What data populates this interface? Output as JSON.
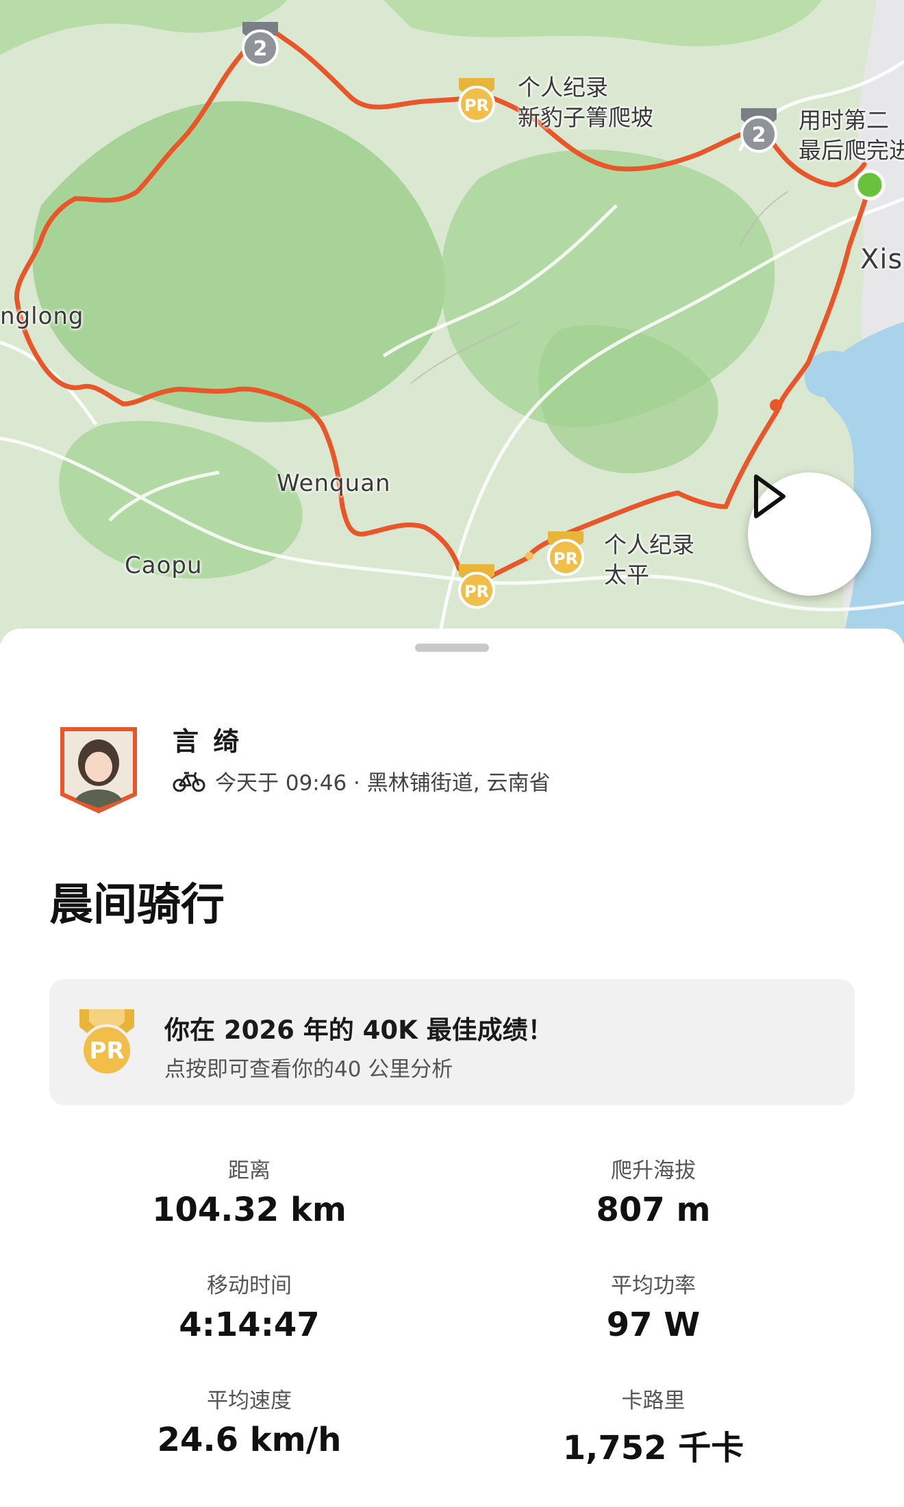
{
  "map": {
    "places": [
      "nglong",
      "Wenquan",
      "Caopu",
      "Xis"
    ],
    "segments": [
      {
        "line1": "个人纪录",
        "line2": "新豹子箐爬坡",
        "badge": "PR"
      },
      {
        "line1": "用时第二",
        "line2": "最后爬完进",
        "badge": "2"
      },
      {
        "line1": "个人纪录",
        "line2": "太平",
        "badge": "PR"
      }
    ],
    "badges": {
      "top_left": "2",
      "bottom": "PR"
    },
    "colors": {
      "route": "#e8562a",
      "start": "#6ac13c",
      "land": "#d9e6cf",
      "forest": "#9fcf8e",
      "water": "#a9d3ea",
      "pr_gold": "#e9b43a"
    },
    "play_icon": "play-icon"
  },
  "activity": {
    "athlete": "言 绮",
    "sport_icon": "bike-icon",
    "meta": "今天于 09:46 · 黑林铺街道, 云南省",
    "title": "晨间骑行"
  },
  "pr_banner": {
    "title": "你在 2026 年的 40K 最佳成绩！",
    "subtitle": "点按即可查看你的40 公里分析",
    "icon": "PR"
  },
  "stats": [
    {
      "label": "距离",
      "value": "104.32 km"
    },
    {
      "label": "爬升海拔",
      "value": "807 m"
    },
    {
      "label": "移动时间",
      "value": "4:14:47"
    },
    {
      "label": "平均功率",
      "value": "97 W"
    },
    {
      "label": "平均速度",
      "value": "24.6 km/h"
    },
    {
      "label": "卡路里",
      "value": "1,752 千卡"
    }
  ]
}
